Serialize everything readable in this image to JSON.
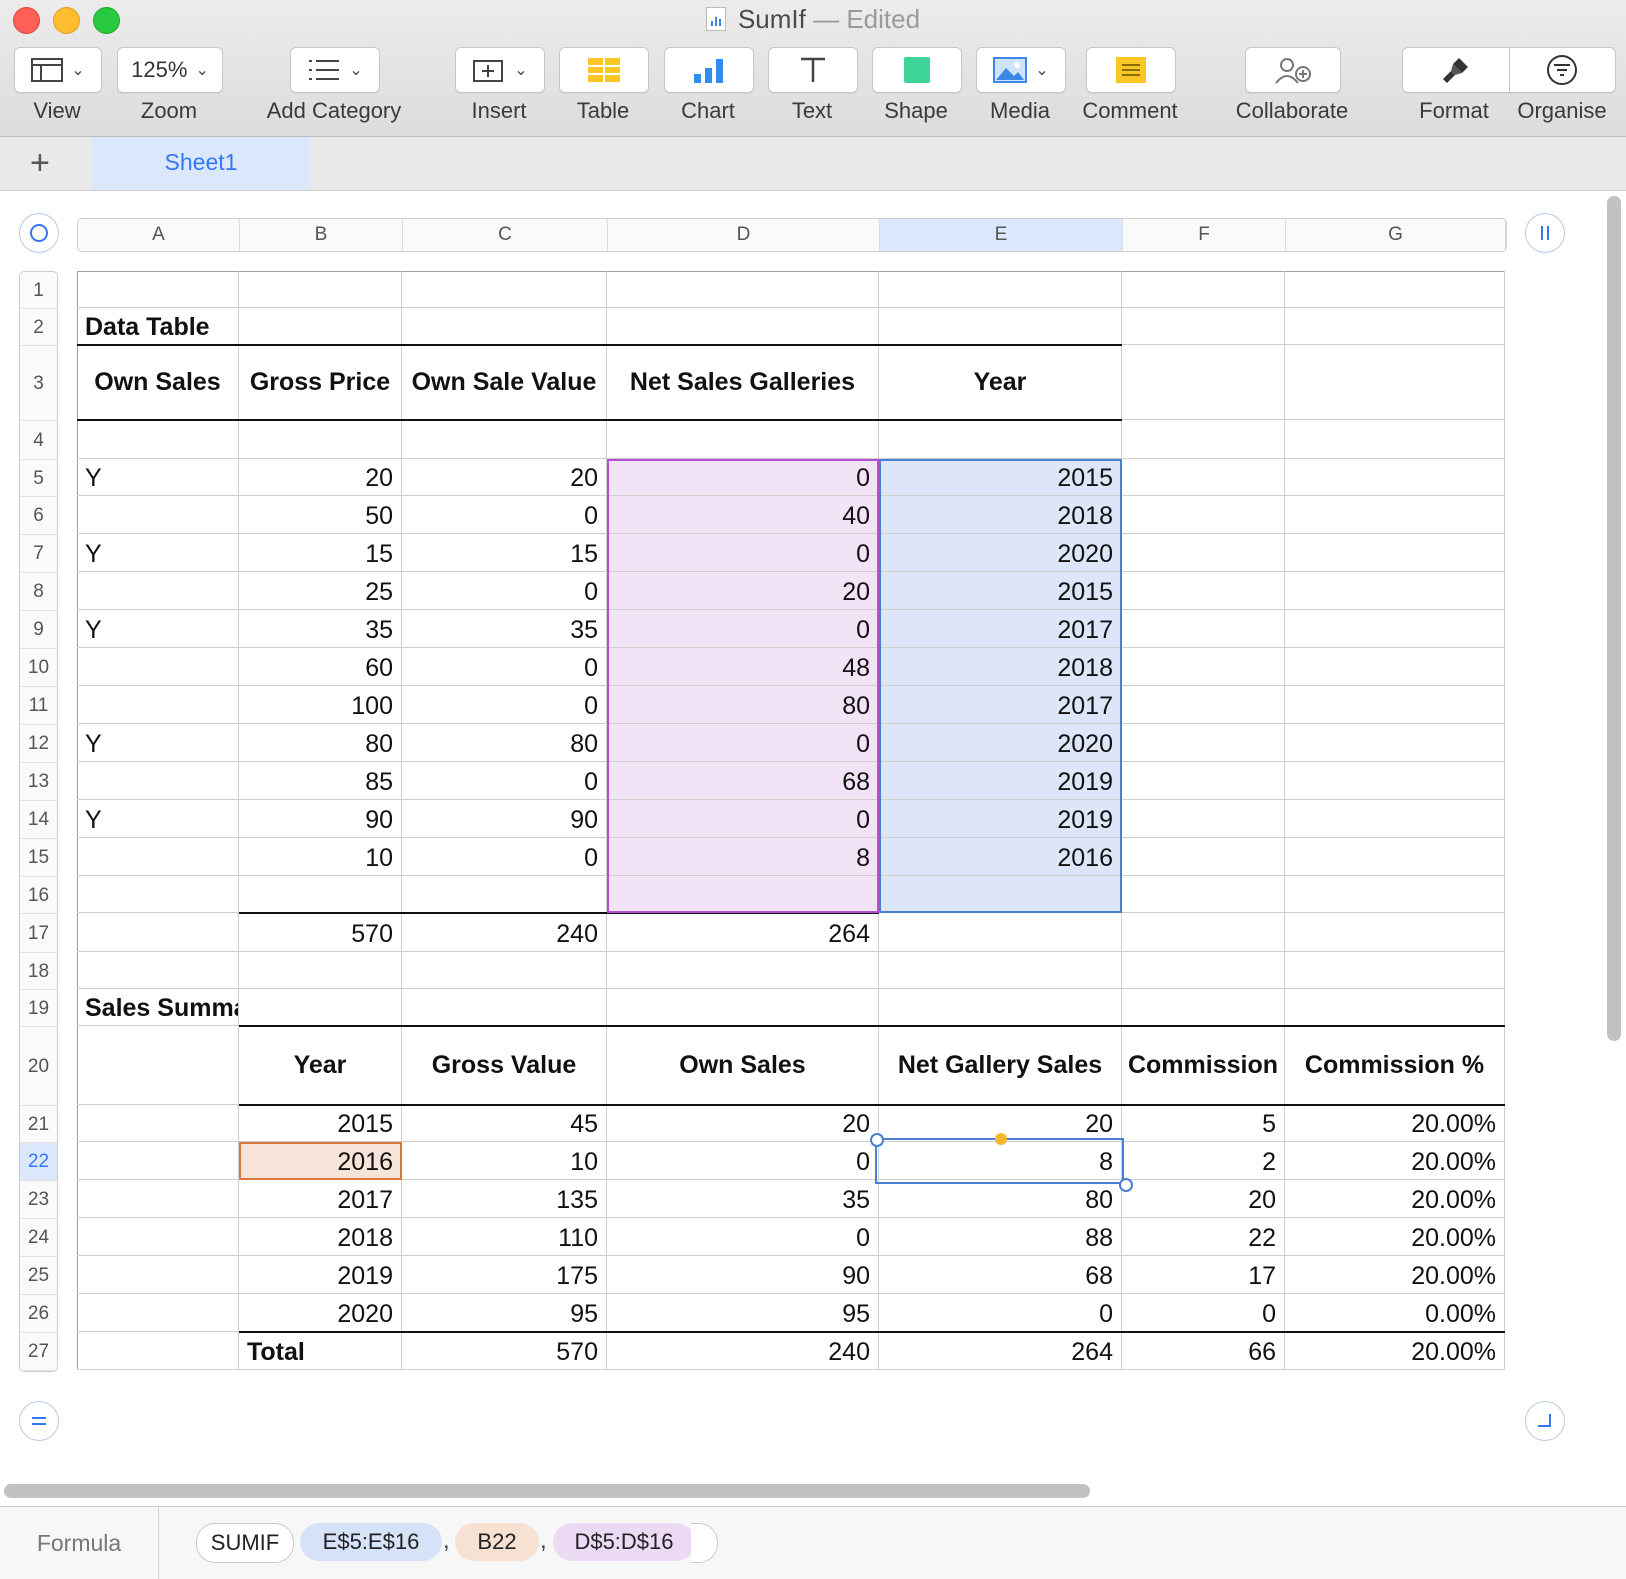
{
  "window": {
    "title": "SumIf",
    "separator": "—",
    "status": "Edited"
  },
  "toolbar": {
    "view": "View",
    "zoom_value": "125%",
    "zoom": "Zoom",
    "add_category": "Add Category",
    "insert": "Insert",
    "table": "Table",
    "chart": "Chart",
    "text": "Text",
    "shape": "Shape",
    "media": "Media",
    "comment": "Comment",
    "collaborate": "Collaborate",
    "format": "Format",
    "organise": "Organise"
  },
  "sheet_tabs": {
    "add": "+",
    "active": "Sheet1"
  },
  "columns": [
    "A",
    "B",
    "C",
    "D",
    "E",
    "F",
    "G"
  ],
  "selected_column": "E",
  "rows": [
    "1",
    "2",
    "3",
    "4",
    "5",
    "6",
    "7",
    "8",
    "9",
    "10",
    "11",
    "12",
    "13",
    "14",
    "15",
    "16",
    "17",
    "18",
    "19",
    "20",
    "21",
    "22",
    "23",
    "24",
    "25",
    "26",
    "27"
  ],
  "selected_row": "22",
  "data_table": {
    "title": "Data Table",
    "headers": [
      "Own Sales",
      "Gross Price",
      "Own Sale Value",
      "Net Sales Galleries",
      "Year"
    ],
    "rows": [
      [
        "Y",
        "20",
        "20",
        "0",
        "2015"
      ],
      [
        "",
        "50",
        "0",
        "40",
        "2018"
      ],
      [
        "Y",
        "15",
        "15",
        "0",
        "2020"
      ],
      [
        "",
        "25",
        "0",
        "20",
        "2015"
      ],
      [
        "Y",
        "35",
        "35",
        "0",
        "2017"
      ],
      [
        "",
        "60",
        "0",
        "48",
        "2018"
      ],
      [
        "",
        "100",
        "0",
        "80",
        "2017"
      ],
      [
        "Y",
        "80",
        "80",
        "0",
        "2020"
      ],
      [
        "",
        "85",
        "0",
        "68",
        "2019"
      ],
      [
        "Y",
        "90",
        "90",
        "0",
        "2019"
      ],
      [
        "",
        "10",
        "0",
        "8",
        "2016"
      ]
    ],
    "totals": [
      "",
      "570",
      "240",
      "264",
      ""
    ]
  },
  "sales_summary": {
    "title": "Sales Summary",
    "headers": [
      "Year",
      "Gross Value",
      "Own Sales",
      "Net Gallery Sales",
      "Commission",
      "Commission %"
    ],
    "rows": [
      [
        "2015",
        "45",
        "20",
        "20",
        "5",
        "20.00%"
      ],
      [
        "2016",
        "10",
        "0",
        "8",
        "2",
        "20.00%"
      ],
      [
        "2017",
        "135",
        "35",
        "80",
        "20",
        "20.00%"
      ],
      [
        "2018",
        "110",
        "0",
        "88",
        "22",
        "20.00%"
      ],
      [
        "2019",
        "175",
        "90",
        "68",
        "17",
        "20.00%"
      ],
      [
        "2020",
        "95",
        "95",
        "0",
        "0",
        "0.00%"
      ]
    ],
    "total_row": [
      "Total",
      "570",
      "240",
      "264",
      "66",
      "20.00%"
    ]
  },
  "formula_bar": {
    "label": "Formula",
    "function": "SUMIF",
    "arg1": "E$5:E$16",
    "sep1": ",",
    "arg2": "B22",
    "sep2": ",",
    "arg3": "D$5:D$16"
  },
  "colors": {
    "accent": "#3478f6",
    "range_purple": "#f2e3f7",
    "range_blue": "#dde6f8",
    "range_peach": "#f6e4d9"
  }
}
